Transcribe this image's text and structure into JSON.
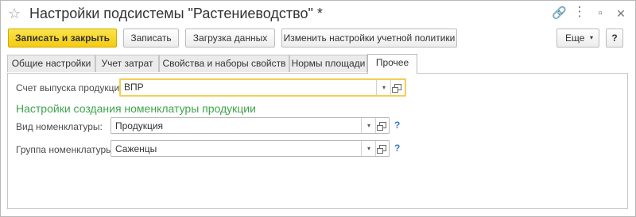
{
  "window": {
    "title": "Настройки подсистемы \"Растениеводство\" *"
  },
  "toolbar": {
    "save_close": "Записать и закрыть",
    "save": "Записать",
    "load_data": "Загрузка данных",
    "change_policy": "Изменить настройки учетной политики",
    "more": "Еще",
    "help": "?"
  },
  "tabs": [
    {
      "label": "Общие настройки"
    },
    {
      "label": "Учет затрат"
    },
    {
      "label": "Свойства и наборы свойств"
    },
    {
      "label": "Нормы площади"
    },
    {
      "label": "Прочее"
    }
  ],
  "form": {
    "output_account_label": "Счет выпуска продукции:",
    "output_account_value": "ВПР",
    "section_title": "Настройки создания номенклатуры продукции",
    "item_type_label": "Вид номенклатуры:",
    "item_type_value": "Продукция",
    "item_group_label": "Группа номенклатуры:",
    "item_group_value": "Саженцы",
    "help_mark": "?"
  },
  "colors": {
    "primary_button": "#f4cb10",
    "section_title": "#3fa34d",
    "focus_border": "#f3cf55",
    "help_link": "#3a7cc4"
  }
}
